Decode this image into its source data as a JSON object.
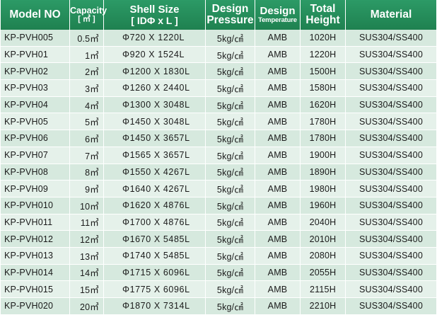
{
  "table": {
    "headers": [
      {
        "key": "model",
        "lines": [
          "Model NO"
        ]
      },
      {
        "key": "capacity",
        "lines": [
          "Capacity",
          "[ ㎥ ]"
        ]
      },
      {
        "key": "shell",
        "lines": [
          "Shell Size",
          "[ IDΦ x L ]"
        ]
      },
      {
        "key": "pressure",
        "lines": [
          "Design",
          "Pressure"
        ]
      },
      {
        "key": "temperature",
        "lines": [
          "Design",
          "Temperature"
        ]
      },
      {
        "key": "height",
        "lines": [
          "Total",
          "Height"
        ]
      },
      {
        "key": "material",
        "lines": [
          "Material"
        ]
      }
    ],
    "rows": [
      [
        "KP-PVH005",
        "0.5㎥",
        "Φ720 X 1220L",
        "5kg/㎠",
        "AMB",
        "1020H",
        "SUS304/SS400"
      ],
      [
        "KP-PVH01",
        "1㎥",
        "Φ920 X 1524L",
        "5kg/㎠",
        "AMB",
        "1220H",
        "SUS304/SS400"
      ],
      [
        "KP-PVH02",
        "2㎥",
        "Φ1200 X 1830L",
        "5kg/㎠",
        "AMB",
        "1500H",
        "SUS304/SS400"
      ],
      [
        "KP-PVH03",
        "3㎥",
        "Φ1260 X 2440L",
        "5kg/㎠",
        "AMB",
        "1580H",
        "SUS304/SS400"
      ],
      [
        "KP-PVH04",
        "4㎥",
        "Φ1300 X 3048L",
        "5kg/㎠",
        "AMB",
        "1620H",
        "SUS304/SS400"
      ],
      [
        "KP-PVH05",
        "5㎥",
        "Φ1450 X 3048L",
        "5kg/㎠",
        "AMB",
        "1780H",
        "SUS304/SS400"
      ],
      [
        "KP-PVH06",
        "6㎥",
        "Φ1450 X 3657L",
        "5kg/㎠",
        "AMB",
        "1780H",
        "SUS304/SS400"
      ],
      [
        "KP-PVH07",
        "7㎥",
        "Φ1565 X 3657L",
        "5kg/㎠",
        "AMB",
        "1900H",
        "SUS304/SS400"
      ],
      [
        "KP-PVH08",
        "8㎥",
        "Φ1550 X 4267L",
        "5kg/㎠",
        "AMB",
        "1890H",
        "SUS304/SS400"
      ],
      [
        "KP-PVH09",
        "9㎥",
        "Φ1640 X 4267L",
        "5kg/㎠",
        "AMB",
        "1980H",
        "SUS304/SS400"
      ],
      [
        "KP-PVH010",
        "10㎥",
        "Φ1620 X 4876L",
        "5kg/㎠",
        "AMB",
        "1960H",
        "SUS304/SS400"
      ],
      [
        "KP-PVH011",
        "11㎥",
        "Φ1700 X 4876L",
        "5kg/㎠",
        "AMB",
        "2040H",
        "SUS304/SS400"
      ],
      [
        "KP-PVH012",
        "12㎥",
        "Φ1670 X 5485L",
        "5kg/㎠",
        "AMB",
        "2010H",
        "SUS304/SS400"
      ],
      [
        "KP-PVH013",
        "13㎥",
        "Φ1740 X 5485L",
        "5kg/㎠",
        "AMB",
        "2080H",
        "SUS304/SS400"
      ],
      [
        "KP-PVH014",
        "14㎥",
        "Φ1715 X 6096L",
        "5kg/㎠",
        "AMB",
        "2055H",
        "SUS304/SS400"
      ],
      [
        "KP-PVH015",
        "15㎥",
        "Φ1775 X 6096L",
        "5kg/㎠",
        "AMB",
        "2115H",
        "SUS304/SS400"
      ],
      [
        "KP-PVH020",
        "20㎥",
        "Φ1870 X 7314L",
        "5kg/㎠",
        "AMB",
        "2210H",
        "SUS304/SS400"
      ]
    ]
  },
  "colors": {
    "header_bg": "#1f8150",
    "header_text": "#ffffff",
    "row_odd": "#d6e9de",
    "row_even": "#e5f1ea"
  }
}
